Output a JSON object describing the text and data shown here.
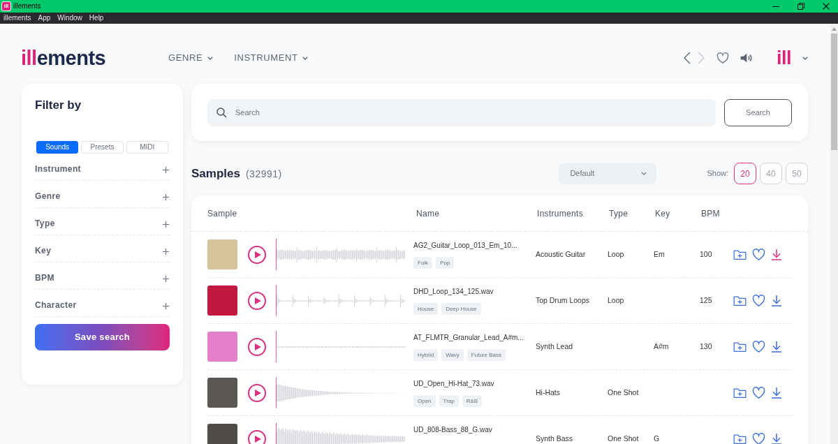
{
  "window": {
    "icon_label": "ill",
    "title": "illements"
  },
  "menu": [
    "illements",
    "App",
    "Window",
    "Help"
  ],
  "header": {
    "logo": {
      "accent": "ill",
      "rest": "ements"
    },
    "nav": [
      {
        "label": "GENRE"
      },
      {
        "label": "INSTRUMENT"
      }
    ],
    "history": {
      "back": {
        "disabled": false
      },
      "forward": {
        "disabled": true
      }
    },
    "account": {
      "label": "ill"
    }
  },
  "sidebar": {
    "title": "Filter by",
    "tabs": [
      {
        "label": "Sounds",
        "selected": true
      },
      {
        "label": "Presets",
        "selected": false
      },
      {
        "label": "MIDI",
        "selected": false
      }
    ],
    "filters": [
      {
        "label": "Instrument"
      },
      {
        "label": "Genre"
      },
      {
        "label": "Type"
      },
      {
        "label": "Key"
      },
      {
        "label": "BPM"
      },
      {
        "label": "Character"
      }
    ],
    "save_button": "Save search"
  },
  "search": {
    "placeholder": "Search",
    "button": "Search"
  },
  "results": {
    "title": "Samples",
    "count": "(32991)",
    "sort": {
      "value": "Default"
    },
    "show_label": "Show:",
    "page_sizes": [
      {
        "label": "20",
        "selected": true
      },
      {
        "label": "40",
        "selected": false
      },
      {
        "label": "50",
        "selected": false
      }
    ]
  },
  "table": {
    "columns": [
      "Sample",
      "Name",
      "Instruments",
      "Type",
      "Key",
      "BPM"
    ],
    "rows": [
      {
        "color": "#d8c49c",
        "kind": "loop",
        "name": "AG2_Guitar_Loop_013_Em_10...",
        "tags": [
          "Folk",
          "Pop"
        ],
        "instrument": "Acoustic Guitar",
        "type": "Loop",
        "key": "Em",
        "bpm": "100",
        "downloaded": true
      },
      {
        "color": "#c2173f",
        "kind": "drums",
        "name": "DHD_Loop_134_125.wav",
        "tags": [
          "House",
          "Deep House"
        ],
        "instrument": "Top Drum Loops",
        "type": "Loop",
        "bpm": "125",
        "downloaded": false
      },
      {
        "color": "#e47fc9",
        "kind": "lead",
        "name": "AT_FLMTR_Granular_Lead_A#m...",
        "tags": [
          "Hybrid",
          "Wavy",
          "Future Bass"
        ],
        "instrument": "Synth Lead",
        "key": "A#m",
        "bpm": "130",
        "downloaded": false
      },
      {
        "color": "#5b5752",
        "kind": "hit",
        "name": "UD_Open_Hi-Hat_73.wav",
        "tags": [
          "Open",
          "Trap",
          "R&B"
        ],
        "instrument": "Hi-Hats",
        "type": "One Shot",
        "downloaded": false
      },
      {
        "color": "#4f4b47",
        "kind": "bass",
        "name": "UD_808-Bass_88_G.wav",
        "instrument": "Synth Bass",
        "type": "One Shot",
        "key": "G",
        "downloaded": false
      }
    ]
  }
}
